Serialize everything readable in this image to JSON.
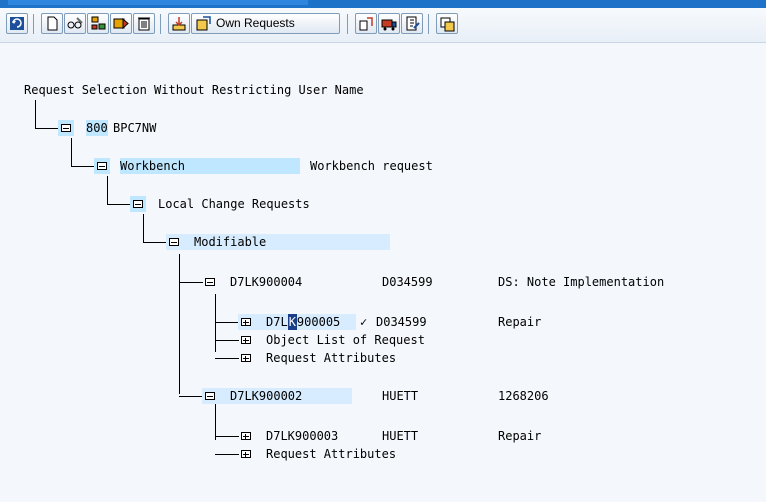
{
  "toolbar": {
    "own_requests_label": "Own Requests"
  },
  "tree": {
    "root_label": "Request Selection Without Restricting User Name",
    "system": {
      "client": "800",
      "name": "BPC7NW"
    },
    "workbench": {
      "label": "Workbench",
      "desc": "Workbench request"
    },
    "local_change": {
      "label": "Local Change Requests"
    },
    "modifiable": {
      "label": "Modifiable"
    },
    "req1": {
      "id": "D7LK900004",
      "owner": "D034599",
      "desc": "DS: Note Implementation"
    },
    "task1": {
      "id_a": "D7L",
      "id_cursor": "K",
      "id_b": "900005",
      "check": "✓",
      "owner": "D034599",
      "desc": "Repair"
    },
    "obj_list": "Object List of Request",
    "req_attr1": "Request Attributes",
    "req2": {
      "id": "D7LK900002",
      "owner": "HUETT",
      "desc": "1268206"
    },
    "task2": {
      "id": "D7LK900003",
      "owner": "HUETT",
      "desc": "Repair"
    },
    "req_attr2": "Request Attributes"
  }
}
